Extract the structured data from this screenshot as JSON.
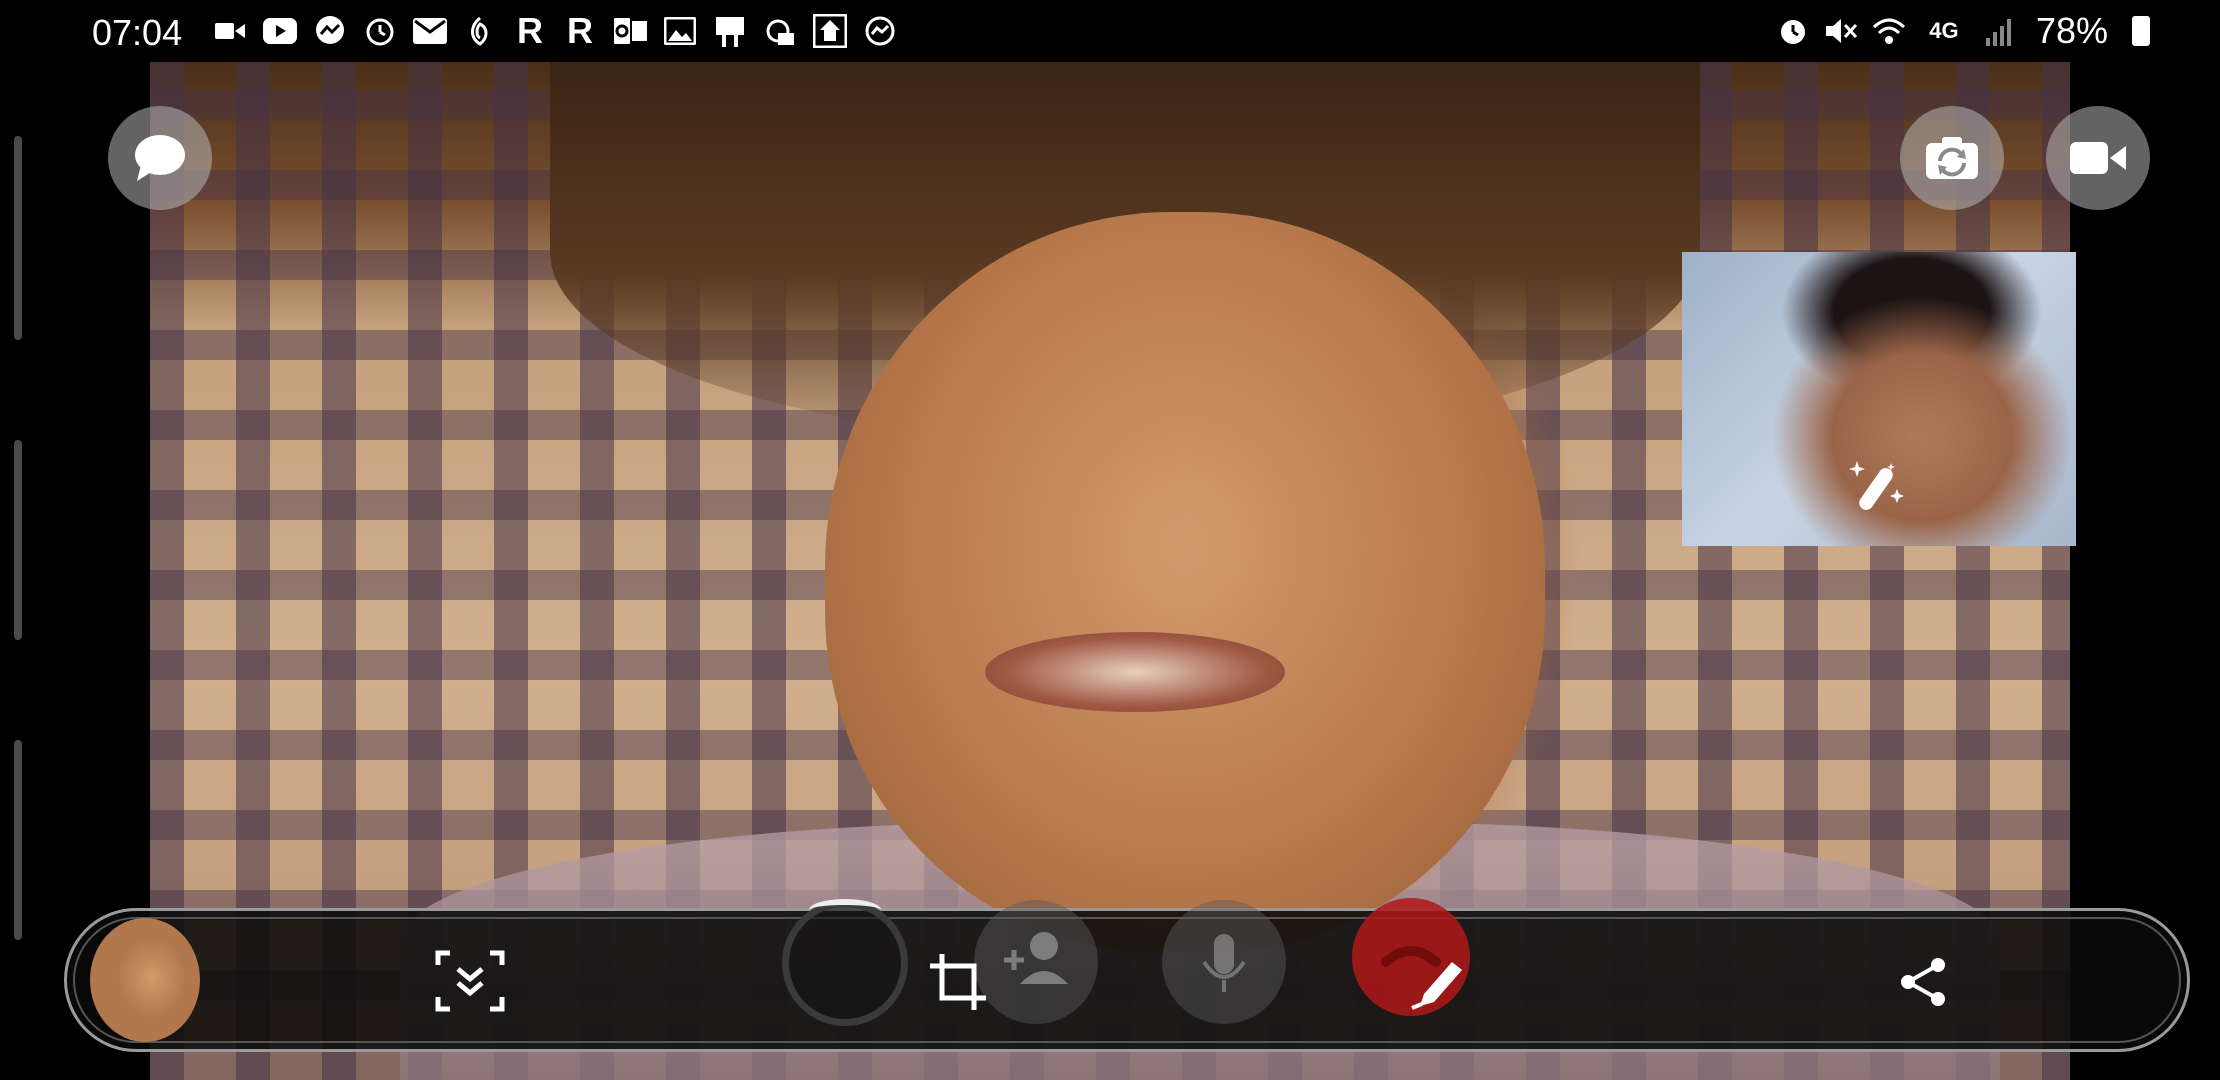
{
  "status_bar": {
    "time": "07:04",
    "notification_icons": [
      "video-icon",
      "youtube-icon",
      "messenger-icon",
      "alarm-icon",
      "mail-icon",
      "swirl-icon",
      "r-icon",
      "r-icon",
      "outlook-icon",
      "gallery-icon",
      "sign-icon",
      "weather-icon",
      "home-icon",
      "messenger-icon"
    ],
    "r_letter": "R",
    "system_icons": [
      "alarm-icon",
      "mute-icon",
      "wifi-icon",
      "lte-icon",
      "signal-icon"
    ],
    "network": "4G",
    "battery": "78%"
  },
  "call": {
    "chat_icon": "chat-bubble-icon",
    "flip_camera_icon": "flip-camera-icon",
    "video_toggle_icon": "video-camera-icon",
    "effects_icon": "magic-wand-icon"
  },
  "toolbar": {
    "items": [
      "screenshot-thumbnail",
      "scroll-capture-icon",
      "crop-icon",
      "draw-icon",
      "share-icon"
    ],
    "background_controls": [
      "capture-button",
      "add-person-icon",
      "microphone-icon",
      "end-call-icon"
    ]
  },
  "colors": {
    "toolbar_bg": "#0a0a0a",
    "toolbar_border": "#9a9a9a",
    "end_call": "#b01818",
    "icon": "#ffffff"
  }
}
